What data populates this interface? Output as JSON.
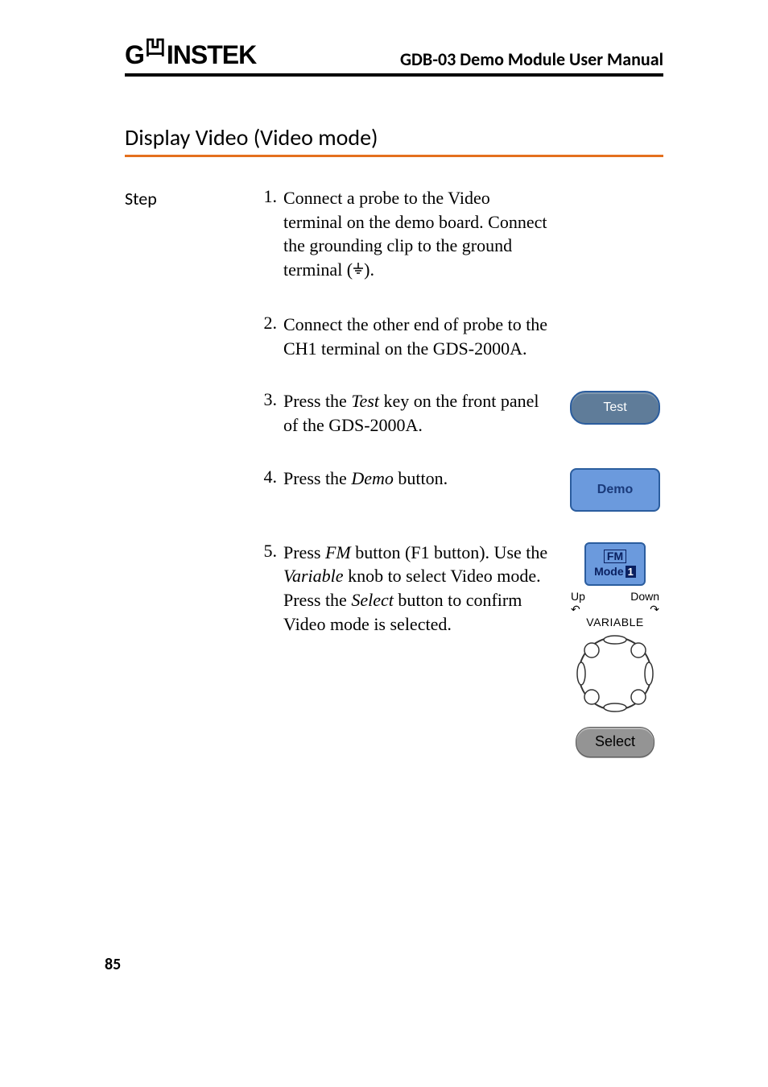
{
  "header": {
    "logo_left": "G",
    "logo_right": "INSTEK",
    "manual_title": "GDB-03 Demo Module User Manual"
  },
  "section_title": "Display Video (Video mode)",
  "step_label": "Step",
  "steps": [
    {
      "num": "1.",
      "text_parts": [
        "Connect a probe to the Video terminal on the demo board. Connect the grounding clip to the ground terminal (",
        ")."
      ]
    },
    {
      "num": "2.",
      "text_parts": [
        "Connect the other end of probe to the CH1 terminal on the GDS-2000A."
      ]
    },
    {
      "num": "3.",
      "text_parts": [
        "Press the ",
        "Test",
        " key on the front panel of the GDS-2000A."
      ],
      "button": {
        "label": "Test"
      }
    },
    {
      "num": "4.",
      "text_parts": [
        "Press the ",
        "Demo",
        " button."
      ],
      "button": {
        "label": "Demo"
      }
    },
    {
      "num": "5.",
      "text_parts": [
        "Press ",
        "FM",
        " button (F1 button). Use the ",
        "Variable",
        " knob to select Video mode. Press the ",
        "Select",
        " button to confirm Video mode is selected."
      ],
      "fm_button": {
        "line1": "FM",
        "line2_prefix": "Mode",
        "line2_num": "1"
      },
      "variable": {
        "up": "Up",
        "down": "Down",
        "label": "VARIABLE"
      },
      "select_button": {
        "label": "Select"
      }
    }
  ],
  "page_number": "85"
}
